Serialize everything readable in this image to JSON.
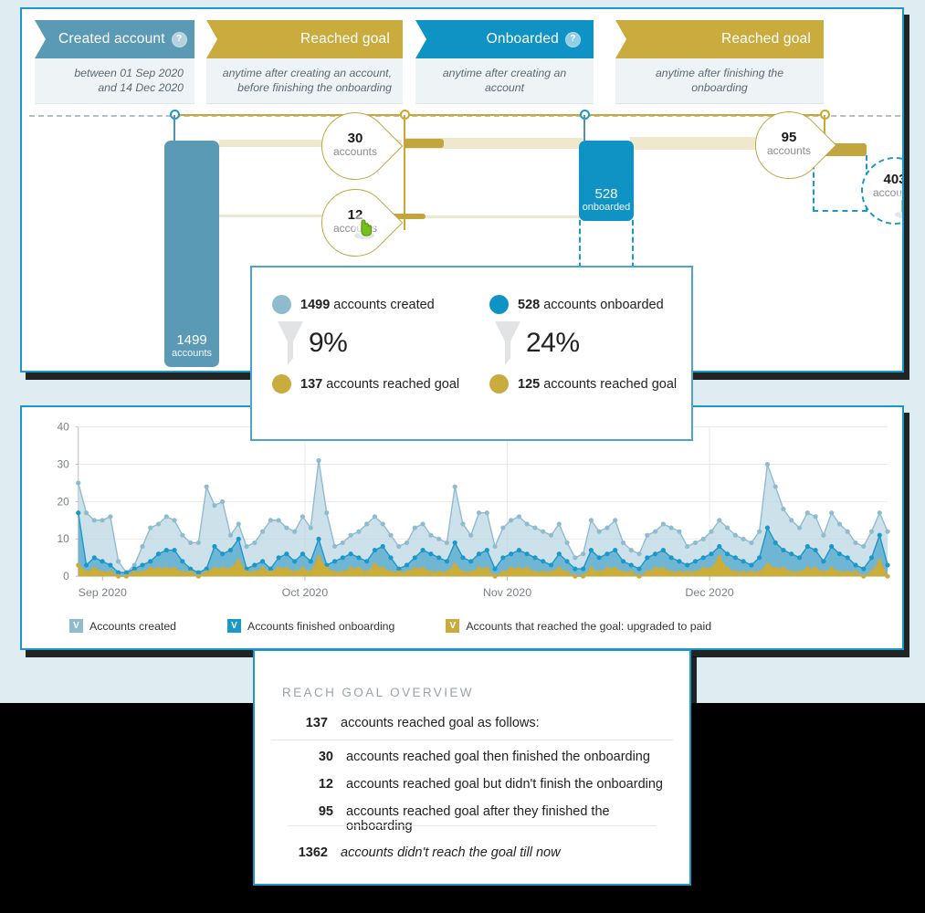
{
  "colors": {
    "created_blue": "#5b9ab5",
    "onboarded_blue": "#0f93c4",
    "gold": "#c9ab3e",
    "border_blue": "#1b97c9",
    "band": "#f0e8cd",
    "backdrop": "#dfedf2"
  },
  "funnel": {
    "steps": [
      {
        "id": "created-account",
        "title": "Created account",
        "has_help": true,
        "help_glyph": "?",
        "subtitle": "between 01 Sep 2020\nand 14 Dec 2020",
        "align": "left",
        "color_key": "created_blue"
      },
      {
        "id": "reached-goal-1",
        "title": "Reached goal",
        "has_help": false,
        "subtitle": "anytime after creating an account,\nbefore finishing the onboarding",
        "align": "right",
        "color_key": "gold"
      },
      {
        "id": "onboarded",
        "title": "Onboarded",
        "has_help": true,
        "help_glyph": "?",
        "subtitle": "anytime after creating an account",
        "align": "right",
        "color_key": "onboarded_blue"
      },
      {
        "id": "reached-goal-2",
        "title": "Reached goal",
        "has_help": false,
        "subtitle": "anytime after finishing the onboarding",
        "align": "right",
        "color_key": "gold"
      }
    ],
    "bars": [
      {
        "id": "created-bar",
        "value": "1499",
        "label": "accounts"
      },
      {
        "id": "onboarded-bar",
        "value": "528",
        "label": "onboarded"
      }
    ],
    "bubbles": [
      {
        "id": "bubble-30",
        "value": "30",
        "label": "accounts",
        "style": "solid"
      },
      {
        "id": "bubble-12",
        "value": "12",
        "label": "accounts",
        "style": "solid"
      },
      {
        "id": "bubble-95",
        "value": "95",
        "label": "accounts",
        "style": "solid"
      },
      {
        "id": "bubble-403",
        "value": "403",
        "label": "accounts",
        "style": "dotted"
      }
    ]
  },
  "conversion": {
    "left": {
      "top_count": "1499",
      "top_text": "accounts created",
      "percent": "9%",
      "bottom_count": "137",
      "bottom_text": "accounts reached goal",
      "top_dot": "#8fbbcf",
      "bottom_dot": "#c9ab3e"
    },
    "right": {
      "top_count": "528",
      "top_text": "accounts onboarded",
      "percent": "24%",
      "bottom_count": "125",
      "bottom_text": "accounts reached goal",
      "top_dot": "#0f93c4",
      "bottom_dot": "#c9ab3e"
    }
  },
  "chart_data": {
    "type": "area",
    "title": "",
    "xlabel": "",
    "ylabel": "",
    "ylim": [
      0,
      40
    ],
    "yticks": [
      0,
      10,
      20,
      30,
      40
    ],
    "xticks": [
      "Sep 2020",
      "Oct 2020",
      "Nov 2020",
      "Dec 2020"
    ],
    "grid": true,
    "legend_position": "bottom-left",
    "series": [
      {
        "name": "Accounts created",
        "color": "#8fbbcf",
        "fill": "#bcd7e4",
        "values": [
          25,
          17,
          15,
          15,
          16,
          4,
          1,
          3,
          8,
          13,
          14,
          16,
          15,
          11,
          9,
          9,
          24,
          19,
          20,
          11,
          14,
          8,
          9,
          12,
          15,
          15,
          13,
          12,
          16,
          13,
          31,
          17,
          8,
          9,
          11,
          12,
          14,
          16,
          14,
          11,
          8,
          9,
          13,
          14,
          11,
          10,
          9,
          24,
          14,
          11,
          17,
          17,
          8,
          13,
          15,
          16,
          14,
          13,
          12,
          11,
          14,
          9,
          5,
          6,
          15,
          12,
          13,
          15,
          9,
          7,
          6,
          11,
          12,
          14,
          13,
          12,
          8,
          9,
          10,
          12,
          15,
          13,
          11,
          10,
          9,
          12,
          30,
          24,
          18,
          15,
          13,
          17,
          16,
          11,
          17,
          14,
          12,
          9,
          8,
          12,
          17,
          12
        ]
      },
      {
        "name": "Accounts finished onboarding",
        "color": "#1b97c9",
        "fill": "#4fa7cd",
        "values": [
          17,
          3,
          5,
          4,
          3,
          1,
          1,
          2,
          3,
          4,
          6,
          7,
          7,
          4,
          2,
          1,
          2,
          8,
          6,
          7,
          10,
          2,
          3,
          4,
          2,
          5,
          6,
          4,
          6,
          4,
          10,
          3,
          4,
          5,
          6,
          5,
          4,
          7,
          8,
          5,
          2,
          3,
          5,
          7,
          6,
          5,
          4,
          9,
          5,
          4,
          6,
          7,
          2,
          5,
          6,
          7,
          6,
          5,
          4,
          3,
          6,
          4,
          2,
          2,
          7,
          5,
          6,
          7,
          4,
          3,
          2,
          5,
          6,
          7,
          5,
          4,
          3,
          4,
          5,
          6,
          8,
          6,
          5,
          4,
          3,
          5,
          13,
          9,
          7,
          6,
          5,
          8,
          7,
          4,
          8,
          6,
          5,
          3,
          2,
          5,
          11,
          3
        ]
      },
      {
        "name": "Accounts that reached the goal: upgraded to paid",
        "color": "#c9ab3e",
        "fill": "#cfae2f",
        "values": [
          3,
          1,
          2,
          1,
          1,
          0,
          0,
          1,
          1,
          2,
          2,
          2,
          2,
          1,
          1,
          0,
          1,
          2,
          2,
          2,
          4,
          1,
          1,
          2,
          1,
          2,
          2,
          1,
          2,
          1,
          5,
          2,
          1,
          1,
          2,
          2,
          1,
          3,
          2,
          1,
          1,
          1,
          2,
          2,
          1,
          1,
          1,
          3,
          1,
          1,
          2,
          2,
          0,
          1,
          2,
          2,
          2,
          1,
          1,
          1,
          2,
          1,
          0,
          0,
          2,
          1,
          2,
          2,
          1,
          1,
          0,
          1,
          2,
          2,
          1,
          1,
          1,
          1,
          2,
          2,
          5,
          2,
          1,
          1,
          1,
          1,
          3,
          2,
          2,
          1,
          1,
          2,
          2,
          1,
          2,
          1,
          1,
          1,
          0,
          1,
          4,
          0
        ]
      }
    ],
    "legend": [
      {
        "label": "Accounts created",
        "color": "#8fbbcf",
        "glyph": "V"
      },
      {
        "label": "Accounts finished onboarding",
        "color": "#1b97c9",
        "glyph": "V"
      },
      {
        "label": "Accounts that reached the goal: upgraded to paid",
        "color": "#c9ab3e",
        "glyph": "V"
      }
    ]
  },
  "overview": {
    "title": "REACH GOAL OVERVIEW",
    "headline": {
      "num": "137",
      "text": "accounts reached goal as follows:"
    },
    "rows": [
      {
        "num": "30",
        "text": "accounts reached goal then finished the onboarding"
      },
      {
        "num": "12",
        "text": "accounts reached goal but didn't finish the onboarding"
      },
      {
        "num": "95",
        "text": "accounts reached goal after they finished the onboarding"
      }
    ],
    "footer": {
      "num": "1362",
      "text": "accounts didn't reach the goal till now"
    }
  }
}
